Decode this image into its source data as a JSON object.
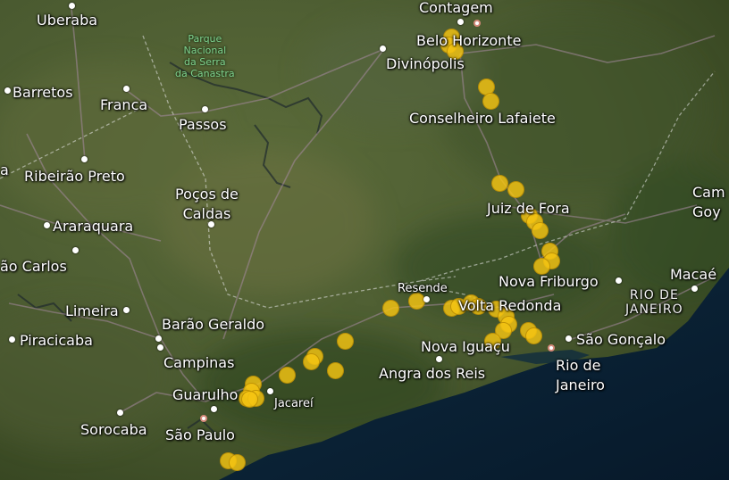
{
  "map": {
    "style": "satellite",
    "marker_color": "#f5c412",
    "city_labels": {
      "uberaba": "Uberaba",
      "contagem": "Contagem",
      "belo_horizonte": "Belo Horizonte",
      "divinopolis": "Divinópolis",
      "barretos": "Barretos",
      "franca": "Franca",
      "passos": "Passos",
      "conselheiro_lafaiete": "Conselheiro Lafaiete",
      "ribeirao_preto": "Ribeirão Preto",
      "pocos_de_caldas": "Poços de\nCaldas",
      "juiz_de_fora": "Juiz de Fora",
      "araraquara": "Araraquara",
      "sao_carlos": "ão Carlos",
      "limeira": "Limeira",
      "barao_geraldo": "Barão Geraldo",
      "resende": "Resende",
      "nova_friburgo": "Nova Friburgo",
      "volta_redonda": "Volta Redonda",
      "macae": "Macaé",
      "piracicaba": "Piracicaba",
      "campinas": "Campinas",
      "nova_iguacu": "Nova Iguaçu",
      "sao_goncalo": "São Gonçalo",
      "rio_de_janeiro": "Rio de\nJaneiro",
      "angra_dos_reis": "Angra dos Reis",
      "guarulhos": "Guarulho",
      "jacarei": "Jacareí",
      "sorocaba": "Sorocaba",
      "sao_paulo": "São Paulo",
      "campos_goy": "Cam\nGoy",
      "edge_a": "a"
    },
    "park_label": "Parque\nNacional\nda Serra\nda Canastra",
    "state_label": "RIO DE\nJANEIRO",
    "marker_count": 38
  }
}
